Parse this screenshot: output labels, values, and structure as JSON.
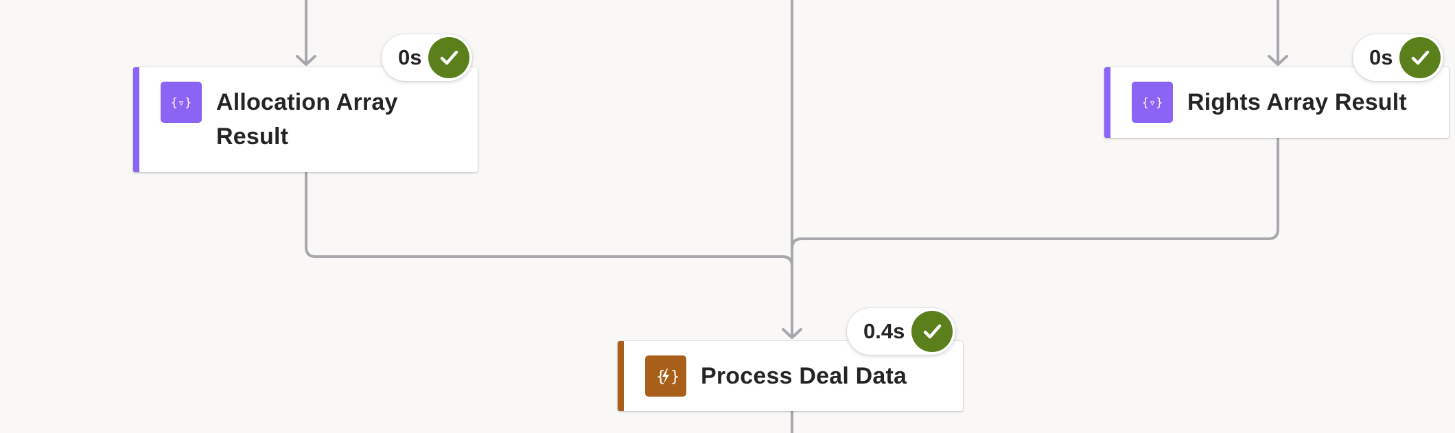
{
  "colors": {
    "canvas_bg": "#f9f8f6",
    "connector": "#a8a7ad",
    "variable_accent": "#8b63f5",
    "compose_accent": "#a85f1a",
    "success": "#5b7f1a"
  },
  "nodes": {
    "allocation": {
      "title": "Allocation Array Result",
      "icon": "variable-braces-icon",
      "duration": "0s",
      "status": "succeeded"
    },
    "rights": {
      "title": "Rights Array Result",
      "icon": "variable-braces-icon",
      "duration": "0s",
      "status": "succeeded"
    },
    "process": {
      "title": "Process Deal Data",
      "icon": "compose-function-icon",
      "duration": "0.4s",
      "status": "succeeded"
    }
  }
}
